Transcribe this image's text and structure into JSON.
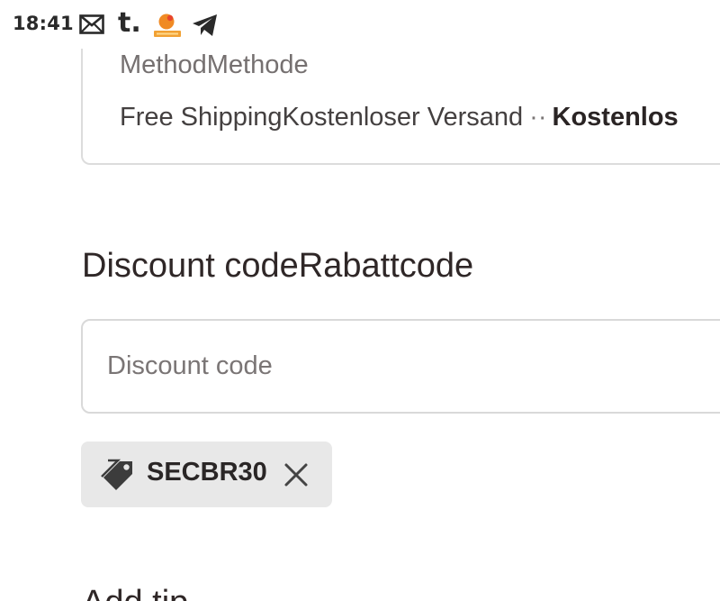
{
  "status_bar": {
    "time": "18:41",
    "icons": [
      "mail-icon",
      "tumblr-icon",
      "app-icon",
      "telegram-icon"
    ],
    "tumblr_glyph": "t."
  },
  "shipping": {
    "method_label": "MethodMethode",
    "option_name": "Free ShippingKostenloser Versand",
    "separator": "··",
    "price": "Kostenlos"
  },
  "discount": {
    "heading": "Discount codeRabattcode",
    "input_placeholder": "Discount code",
    "input_value": "",
    "applied_code": "SECBR30",
    "tag_icon": "tag-icon",
    "remove_icon": "close-icon"
  },
  "next_section": {
    "heading": "Add tip"
  },
  "colors": {
    "text": "#2f2727",
    "muted_text": "#757070",
    "border": "#dcdcdc",
    "tag_background": "#e8e8e8",
    "icon": "#3c3c3c"
  }
}
